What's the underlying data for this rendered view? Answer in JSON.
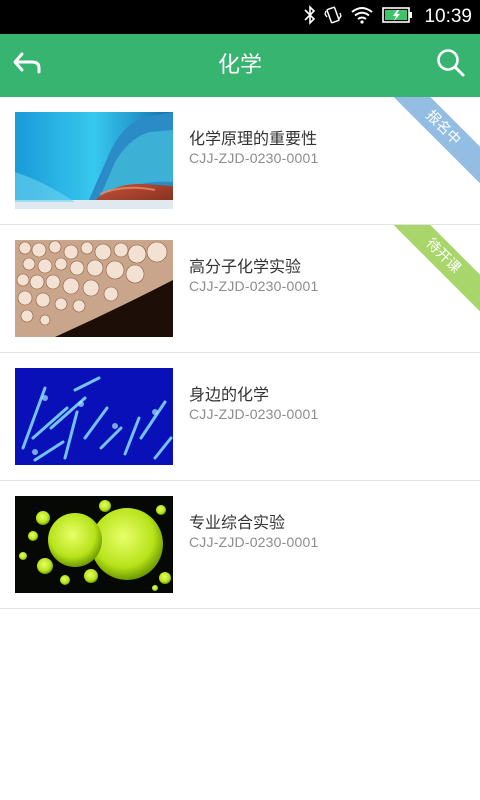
{
  "status_bar": {
    "time": "10:39",
    "icons": [
      "bluetooth-icon",
      "vibrate-icon",
      "wifi-icon",
      "battery-charging-icon"
    ]
  },
  "header": {
    "title": "化学",
    "back_icon": "back-arrow-icon",
    "search_icon": "search-icon",
    "background": "#37b46f"
  },
  "courses": [
    {
      "title": "化学原理的重要性",
      "code": "CJJ-ZJD-0230-0001",
      "badge": "报名中",
      "badge_color": "#93bde3",
      "thumbnail": "blue-crystal-thumbnail"
    },
    {
      "title": "高分子化学实验",
      "code": "CJJ-ZJD-0230-0001",
      "badge": "待开课",
      "badge_color": "#a9d66b",
      "thumbnail": "bubbles-thumbnail"
    },
    {
      "title": "身边的化学",
      "code": "CJJ-ZJD-0230-0001",
      "badge": "",
      "thumbnail": "blue-glow-crystals-thumbnail"
    },
    {
      "title": "专业综合实验",
      "code": "CJJ-ZJD-0230-0001",
      "badge": "",
      "thumbnail": "green-cells-thumbnail"
    }
  ]
}
